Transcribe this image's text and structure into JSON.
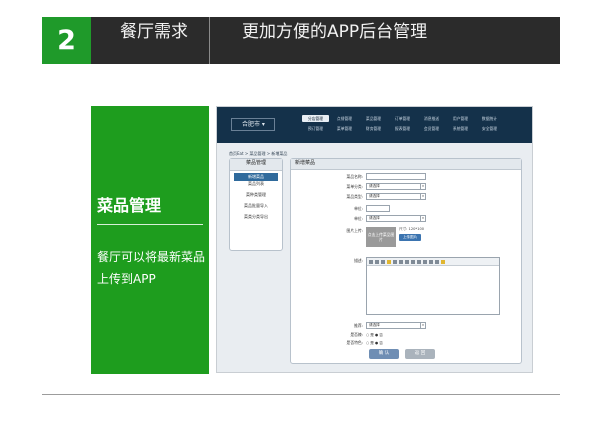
{
  "header": {
    "number": "2",
    "section": "餐厅需求",
    "title": "更加方便的APP后台管理"
  },
  "panel": {
    "title": "菜品管理",
    "description": "餐厅可以将最新菜品上传到APP"
  },
  "app": {
    "city": "合肥市",
    "nav": [
      "分店管理",
      "点餐管理",
      "菜品管理",
      "订单管理",
      "消息推送",
      "用户管理",
      "数据统计",
      "预订管理",
      "菜单管理",
      "财务管理",
      "报表管理",
      "会员管理",
      "系统管理",
      "安全管理"
    ],
    "nav_active": [
      1,
      0,
      0,
      0,
      0,
      0,
      0,
      0,
      0,
      0,
      0,
      0,
      0,
      0
    ],
    "breadcrumb": "首页Eat > 菜品管理 > 新增菜品",
    "sidebar": {
      "title": "菜品管理",
      "items": [
        "新增菜品",
        "菜品列表",
        "菜种类管理",
        "菜品批量导入",
        "菜类分类导出"
      ]
    },
    "form": {
      "title": "新增菜品",
      "fields": [
        {
          "label": "菜品名称:",
          "value": "",
          "width": 60,
          "dropdown": false
        },
        {
          "label": "菜单分类:",
          "value": "请选择",
          "width": 60,
          "dropdown": true
        },
        {
          "label": "菜品类型:",
          "value": "请选择",
          "width": 60,
          "dropdown": true
        },
        {
          "label": "单位:",
          "value": "",
          "width": 24,
          "dropdown": false
        },
        {
          "label": "单位:",
          "value": "请选择",
          "width": 60,
          "dropdown": true
        }
      ],
      "image_label": "图片上传:",
      "upload_box": "点击上传菜品图片",
      "upload_tip": "尺寸: 120*100",
      "upload_button": "上传图片",
      "desc_label": "描述:",
      "recommend_label": "推荐:",
      "recommend_value": "请选择",
      "spicy_label": "是否辣:",
      "spicy_yes": "是",
      "spicy_no": "否",
      "feature_label": "是否特色:",
      "feature_yes": "是",
      "feature_no": "否",
      "ok_button": "确 认",
      "back_button": "返 回"
    }
  }
}
